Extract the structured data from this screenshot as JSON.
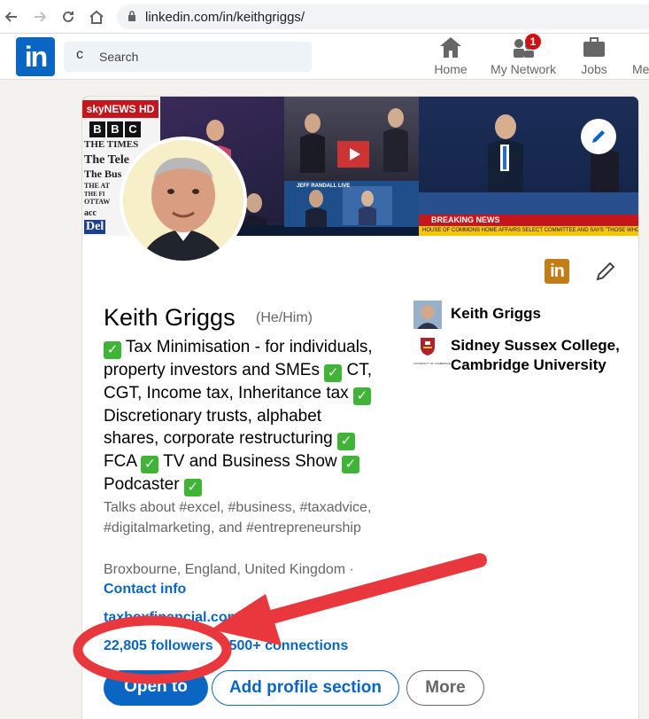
{
  "browser": {
    "url": "linkedin.com/in/keithgriggs/"
  },
  "nav": {
    "logo": "in",
    "search_placeholder": "Search",
    "items": [
      {
        "label": "Home"
      },
      {
        "label": "My Network",
        "badge": "1"
      },
      {
        "label": "Jobs"
      },
      {
        "label": "Me"
      }
    ]
  },
  "banner": {
    "sky_label": "skyNEWS HD",
    "bbc_letters": [
      "B",
      "B",
      "C"
    ],
    "paper_lines": [
      "THE TIMES",
      "The Tele",
      "The Bus",
      "THE AT",
      "THE FI",
      "OTTAW",
      "acc",
      "Del"
    ],
    "breaking": "BREAKING NEWS",
    "ticker": "HOUSE OF COMMONS HOME AFFAIRS SELECT COMMITTEE AND SAYS \"THOSE WHO HOLD PRIVATE",
    "tile_labels": [
      "JEFF RANDALL LIVE"
    ]
  },
  "profile": {
    "name": "Keith Griggs",
    "pronouns": "(He/Him)",
    "headline_parts": [
      {
        "check": true,
        "text": " Tax Minimisation - for individuals, property investors and SMEs "
      },
      {
        "check": true,
        "text": " CT, CGT, Income tax, Inheritance tax "
      },
      {
        "check": true,
        "text": " Discretionary trusts, alphabet shares, corporate restructuring "
      },
      {
        "check": true,
        "text": " FCA "
      },
      {
        "check": true,
        "text": " TV and Business Show "
      },
      {
        "check": true,
        "text": " Podcaster "
      },
      {
        "check": true,
        "text": ""
      }
    ],
    "talks_about": "Talks about #excel, #business, #taxadvice, #digitalmarketing, and #entrepreneurship",
    "location": "Broxbourne, England, United Kingdom ·",
    "contact_info": "Contact info",
    "website": "taxboxfinancial.com",
    "followers": "22,805 followers",
    "connections": "500+ connections",
    "company": "Keith Griggs",
    "education": "Sidney Sussex College, Cambridge University",
    "education_logo_text": "UNIVERSITY OF CAMBRIDGE"
  },
  "actions": {
    "open_to": "Open to",
    "add_section": "Add profile section",
    "more": "More"
  },
  "annotation": {
    "color": "#e8383d"
  }
}
